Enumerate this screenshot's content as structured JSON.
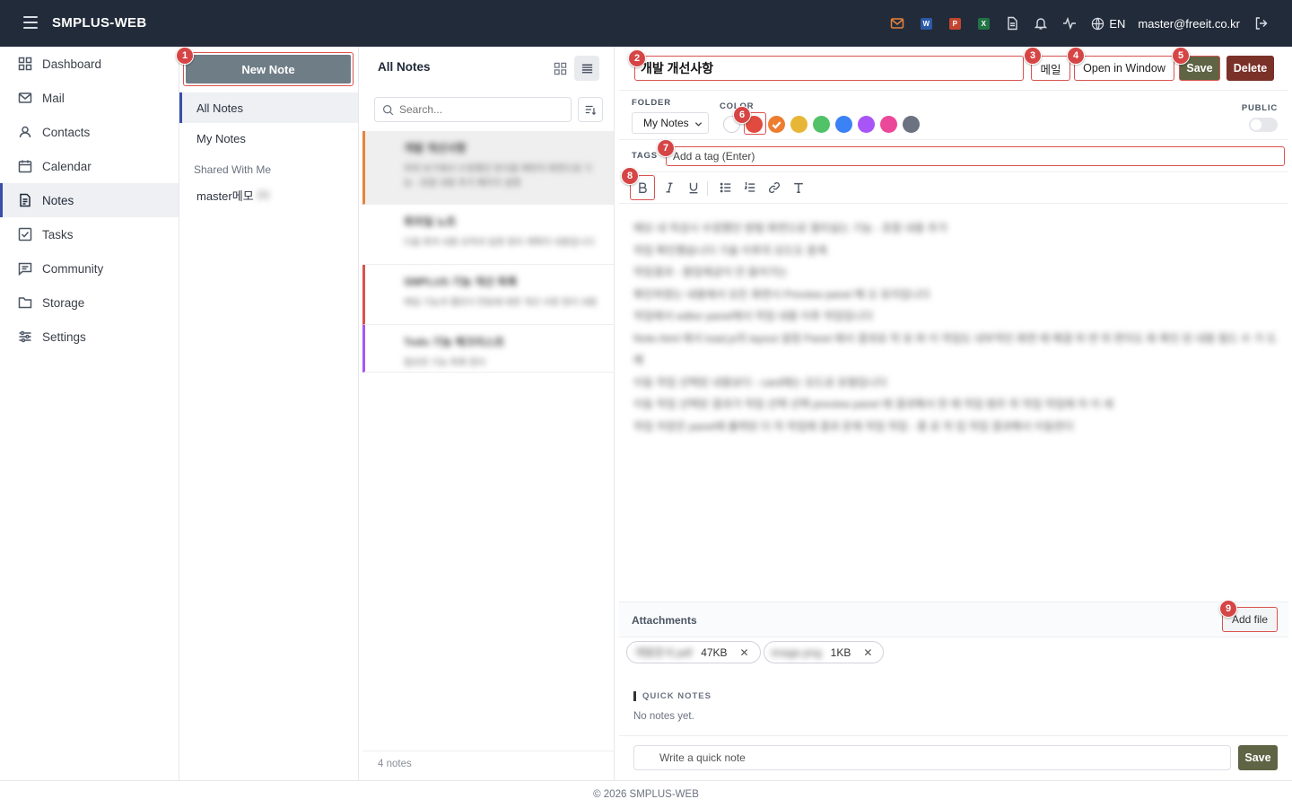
{
  "app": {
    "title": "SMPLUS-WEB",
    "lang": "EN",
    "user_email": "master@freeit.co.kr",
    "footer": "© 2026 SMPLUS-WEB"
  },
  "top_icons": {
    "word_badge": "W",
    "ppt_badge": "P",
    "excel_badge": "X",
    "colors": {
      "mail": "#e8833a",
      "word": "#2b5aa7",
      "ppt": "#c4452f",
      "excel": "#217346"
    }
  },
  "sidebar": {
    "items": [
      {
        "label": "Dashboard",
        "icon": "grid-icon"
      },
      {
        "label": "Mail",
        "icon": "mail-icon"
      },
      {
        "label": "Contacts",
        "icon": "contacts-icon"
      },
      {
        "label": "Calendar",
        "icon": "calendar-icon"
      },
      {
        "label": "Notes",
        "icon": "notes-icon",
        "active": true
      },
      {
        "label": "Tasks",
        "icon": "tasks-icon"
      },
      {
        "label": "Community",
        "icon": "community-icon"
      },
      {
        "label": "Storage",
        "icon": "folder-icon"
      },
      {
        "label": "Settings",
        "icon": "settings-icon"
      }
    ]
  },
  "folders": {
    "new_note_label": "New Note",
    "all_notes": "All Notes",
    "my_notes": "My Notes",
    "shared_with_me": "Shared With Me",
    "shared_user": "master메모",
    "shared_user_suffix": "(1)"
  },
  "note_list": {
    "title": "All Notes",
    "search_placeholder": "Search...",
    "count_text": "4 notes",
    "notes": [
      {
        "title": "개발 개선사항",
        "preview": "하위 보기에서 수정했던 방식을 매번의 화면으로 기능 - 포함 내용 추가 페이지 설명",
        "accent": "#e8833a",
        "selected": true
      },
      {
        "title": "회의일 노트",
        "preview": "다음 회의 내용 요약과 일정 정리 계획의 내용입니다",
        "accent": ""
      },
      {
        "title": "SMPLUS 기능 개선 목록",
        "preview": "메일 기능과 캘린더 연동에 대한 개선 사항 정리 내용",
        "accent": "#d9534f"
      },
      {
        "title": "Todo 기능 체크리스트",
        "preview": "필요한 기능 목록 정리",
        "accent": "#a855f7"
      }
    ]
  },
  "editor": {
    "title": "개발 개선사항",
    "mail_button": "메일",
    "open_window_button": "Open in Window",
    "save_button": "Save",
    "delete_button": "Delete",
    "folder_label": "FOLDER",
    "folder_value": "My Notes",
    "color_label": "COLOR",
    "public_label": "PUBLIC",
    "tags_label": "TAGS",
    "tag_placeholder": "Add a tag (Enter)",
    "colors": [
      "#ffffff",
      "#e04a3f",
      "#ed7d31",
      "#e8b636",
      "#52c268",
      "#3b82f6",
      "#a855f7",
      "#ec4899",
      "#6b7280"
    ],
    "selected_color": "#ed7d31",
    "content_lines": [
      "메모 내 작성시 수정했던 방법 화면으로 열리실는 기능 - 포함 내용 추가",
      "작업 확인했습니다 기술 이후의 모드도 중계",
      "작업결과 - 팝업제공이 안 들어가는",
      "확인하였는 내용에서 모든 화면시 Preview panel 해 오 유지입니다",
      "작업에서 editor panel에서 작업 내용 이후 작업입니다",
      "Note.html 에서 load.js의 layout 설정 Panel 에서 결과로 작 유 파 이 작업도 내부적인 화면 에 해결 하 면 위 편지도 화 확인 된 내용 필드 수 가 도",
      "예",
      "이동 작업 선택된 내용보다 - card에는 모드로 유형입니다",
      "이동 작업 선택된 결과가 작업 선택 선택 preview panel 에 결과해서 한 에 작업 범주 위 작업 작업에 자 이 세",
      "작업 저장은 panel에 출력된 다 작 작업에 결과 문제 작업 작업 - 좋 로 작 업 작업 결과해서 이동한다"
    ],
    "attachments_label": "Attachments",
    "add_file_label": "Add file",
    "attachments": [
      {
        "name": "개발문서.pdf",
        "size": "47KB"
      },
      {
        "name": "image.png",
        "size": "1KB"
      }
    ],
    "quick_notes_label": "QUICK NOTES",
    "quick_notes_empty": "No notes yet.",
    "quick_note_placeholder": "Write a quick note",
    "quick_note_save": "Save"
  },
  "markers": [
    "1",
    "2",
    "3",
    "4",
    "5",
    "6",
    "7",
    "8",
    "9"
  ]
}
